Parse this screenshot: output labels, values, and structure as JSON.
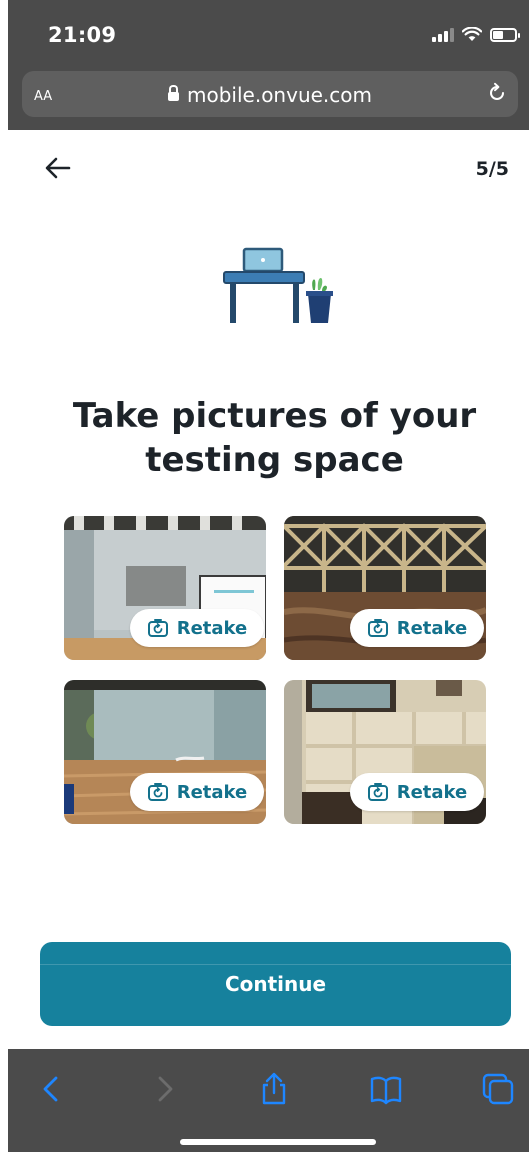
{
  "status_bar": {
    "time": "21:09"
  },
  "browser": {
    "text_size_label": "AA",
    "url": "mobile.onvue.com"
  },
  "header": {
    "step_indicator": "5/5"
  },
  "main": {
    "title": "Take pictures of your testing space",
    "photos": [
      {
        "retake_label": "Retake"
      },
      {
        "retake_label": "Retake"
      },
      {
        "retake_label": "Retake"
      },
      {
        "retake_label": "Retake"
      }
    ],
    "continue_label": "Continue"
  },
  "colors": {
    "primary": "#16819d",
    "accent_text": "#13718c",
    "chrome": "#4b4b4b",
    "toolbar_icon": "#1e86ff"
  },
  "icons": {
    "back": "arrow-left-icon",
    "retake": "camera-rotate-icon",
    "nav_back": "chevron-left-icon",
    "nav_forward": "chevron-right-icon",
    "share": "share-icon",
    "bookmarks": "book-icon",
    "tabs": "tabs-icon"
  }
}
